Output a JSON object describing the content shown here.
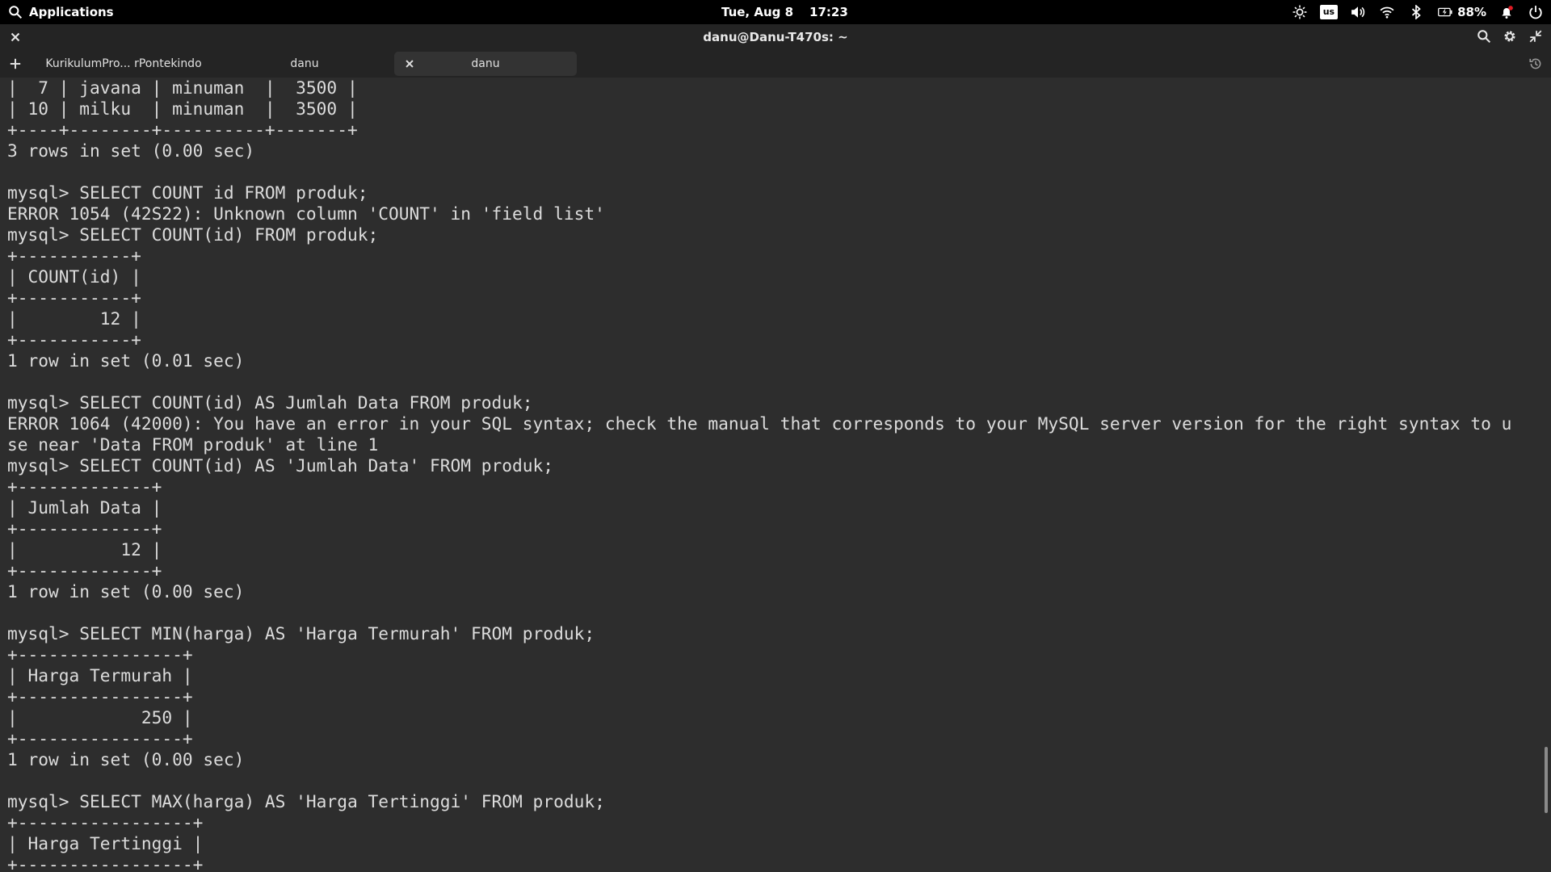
{
  "topbar": {
    "applications_label": "Applications",
    "date": "Tue, Aug 8",
    "time": "17:23",
    "keyboard_layout": "us",
    "battery": "88%"
  },
  "window": {
    "title": "danu@Danu-T470s: ~"
  },
  "tabs": [
    {
      "label": "KurikulumPro... rPontekindo",
      "active": false
    },
    {
      "label": "danu",
      "active": false
    },
    {
      "label": "danu",
      "active": true
    }
  ],
  "terminal": {
    "lines": [
      "|  7 | javana | minuman  |  3500 |",
      "| 10 | milku  | minuman  |  3500 |",
      "+----+--------+----------+-------+",
      "3 rows in set (0.00 sec)",
      "",
      "mysql> SELECT COUNT id FROM produk;",
      "ERROR 1054 (42S22): Unknown column 'COUNT' in 'field list'",
      "mysql> SELECT COUNT(id) FROM produk;",
      "+-----------+",
      "| COUNT(id) |",
      "+-----------+",
      "|        12 |",
      "+-----------+",
      "1 row in set (0.01 sec)",
      "",
      "mysql> SELECT COUNT(id) AS Jumlah Data FROM produk;",
      "ERROR 1064 (42000): You have an error in your SQL syntax; check the manual that corresponds to your MySQL server version for the right syntax to u",
      "se near 'Data FROM produk' at line 1",
      "mysql> SELECT COUNT(id) AS 'Jumlah Data' FROM produk;",
      "+-------------+",
      "| Jumlah Data |",
      "+-------------+",
      "|          12 |",
      "+-------------+",
      "1 row in set (0.00 sec)",
      "",
      "mysql> SELECT MIN(harga) AS 'Harga Termurah' FROM produk;",
      "+----------------+",
      "| Harga Termurah |",
      "+----------------+",
      "|            250 |",
      "+----------------+",
      "1 row in set (0.00 sec)",
      "",
      "mysql> SELECT MAX(harga) AS 'Harga Tertinggi' FROM produk;",
      "+-----------------+",
      "| Harga Tertinggi |",
      "+-----------------+"
    ]
  },
  "colors": {
    "terminal_bg": "#2d2d2d",
    "terminal_fg": "#dcdcdc",
    "panel_bg": "#000000",
    "header_bg": "#242424"
  }
}
